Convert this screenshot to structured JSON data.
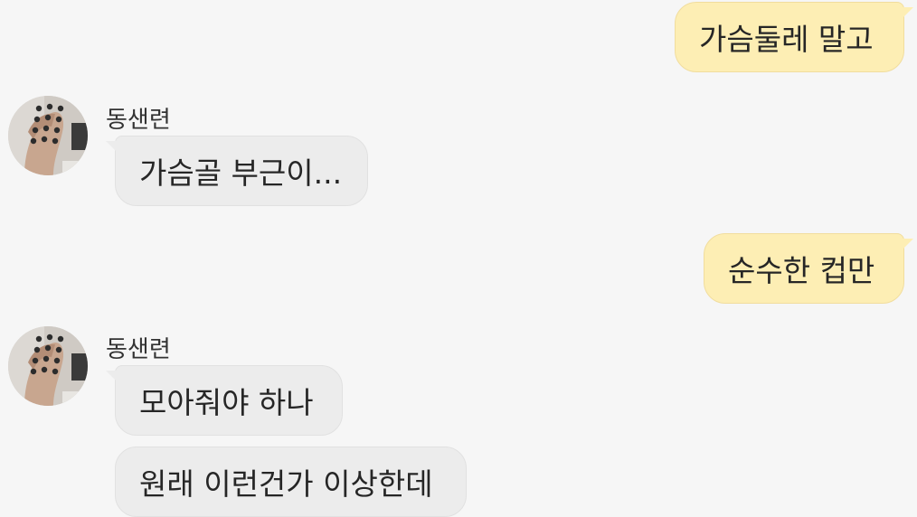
{
  "sender_name": "동샌련",
  "messages": [
    {
      "from": "me",
      "text": "가슴둘레 말고"
    },
    {
      "from": "them",
      "text": "가슴골 부근이..."
    },
    {
      "from": "me",
      "text": "순수한 컵만"
    },
    {
      "from": "them",
      "text": "모아줘야 하나"
    },
    {
      "from": "them",
      "text": "원래 이런건가 이상한데"
    }
  ],
  "colors": {
    "background": "#f6f6f6",
    "my_bubble": "#fdeeb4",
    "their_bubble": "#ececec",
    "text": "#262626"
  },
  "icons": {
    "avatar": "profile-photo-avatar"
  }
}
